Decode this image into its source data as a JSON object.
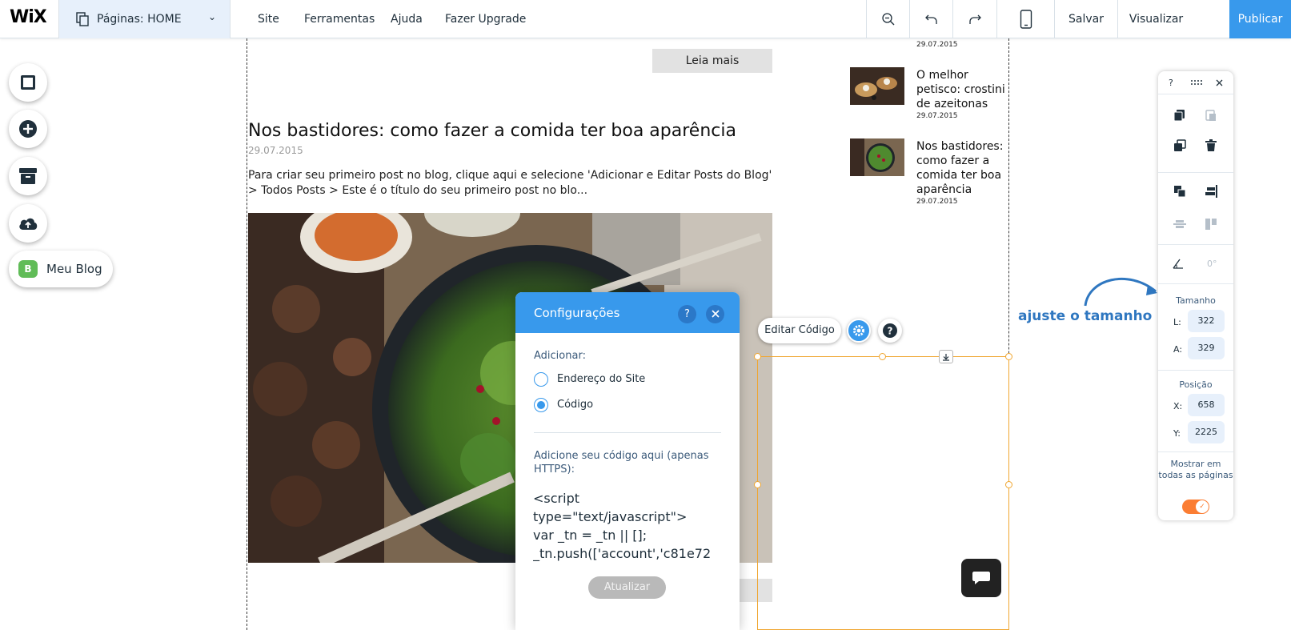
{
  "topbar": {
    "logo": "WiX",
    "pages_label": "Páginas: HOME",
    "menu": [
      "Site",
      "Ferramentas",
      "Ajuda",
      "Fazer Upgrade"
    ],
    "save": "Salvar",
    "preview": "Visualizar",
    "publish": "Publicar"
  },
  "left_rail": {
    "blog_label": "Meu Blog",
    "blog_badge": "B"
  },
  "post": {
    "read_more": "Leia mais",
    "title": "Nos bastidores: como fazer a comida ter boa aparência",
    "date": "29.07.2015",
    "excerpt": "Para criar seu primeiro post no blog, clique aqui e selecione 'Adicionar e Editar Posts do Blog' > Todos Posts > Este é o título do seu primeiro post no blo..."
  },
  "recent_posts": {
    "top_date": "29.07.2015",
    "items": [
      {
        "title": "O melhor petisco: crostini de azeitonas",
        "date": "29.07.2015"
      },
      {
        "title": "Nos bastidores: como fazer a comida ter boa aparência",
        "date": "29.07.2015"
      }
    ]
  },
  "element_toolbar": {
    "edit_code": "Editar Código"
  },
  "settings_panel": {
    "title": "Configurações",
    "help": "?",
    "add_label": "Adicionar:",
    "options": [
      "Endereço do Site",
      "Código"
    ],
    "selected_option": "Código",
    "code_label": "Adicione seu código aqui (apenas HTTPS):",
    "code": "<script\ntype=\"text/javascript\">\nvar _tn = _tn || [];\n_tn.push(['account','c81e72",
    "update": "Atualizar"
  },
  "annotation": "ajuste o tamanho",
  "tools_panel": {
    "help": "?",
    "rotation": "0°",
    "size_heading": "Tamanho",
    "width_label": "L:",
    "width": "322",
    "height_label": "A:",
    "height": "329",
    "position_heading": "Posição",
    "x_label": "X:",
    "x": "658",
    "y_label": "Y:",
    "y": "2225",
    "show_all": "Mostrar em todas as páginas",
    "show_all_enabled": true
  },
  "colors": {
    "accent": "#3899ec",
    "selection": "#f0a630",
    "toggle": "#fb7d33",
    "annotation": "#2f77c0"
  }
}
